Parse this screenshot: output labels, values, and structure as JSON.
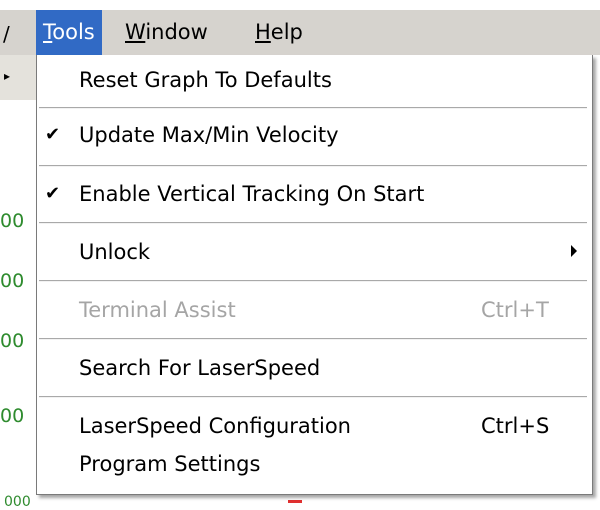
{
  "menubar": {
    "left_fragment": "/",
    "items": [
      {
        "mnemonic": "T",
        "rest": "ools",
        "open": true
      },
      {
        "mnemonic": "W",
        "rest": "indow",
        "open": false
      },
      {
        "mnemonic": "H",
        "rest": "elp",
        "open": false
      }
    ]
  },
  "background": {
    "tick_labels": [
      "00",
      "00",
      "00",
      "00"
    ],
    "bottom_fragment": "000"
  },
  "dropdown": {
    "items": [
      {
        "label": "Reset Graph To Defaults",
        "checked": false,
        "shortcut": "",
        "disabled": false
      },
      {
        "label": "Update Max/Min Velocity",
        "checked": true,
        "shortcut": "",
        "disabled": false
      },
      {
        "label": "Enable Vertical Tracking On Start",
        "checked": true,
        "shortcut": "",
        "disabled": false
      },
      {
        "label": "Unlock",
        "checked": false,
        "shortcut": "",
        "disabled": false,
        "submenu": true
      },
      {
        "label": "Terminal Assist",
        "checked": false,
        "shortcut": "Ctrl+T",
        "disabled": true
      },
      {
        "label": "Search For LaserSpeed",
        "checked": false,
        "shortcut": "",
        "disabled": false
      },
      {
        "label": "LaserSpeed Configuration",
        "checked": false,
        "shortcut": "Ctrl+S",
        "disabled": false
      },
      {
        "label": "Program Settings",
        "checked": false,
        "shortcut": "",
        "disabled": false
      }
    ],
    "check_glyph": "✔"
  }
}
